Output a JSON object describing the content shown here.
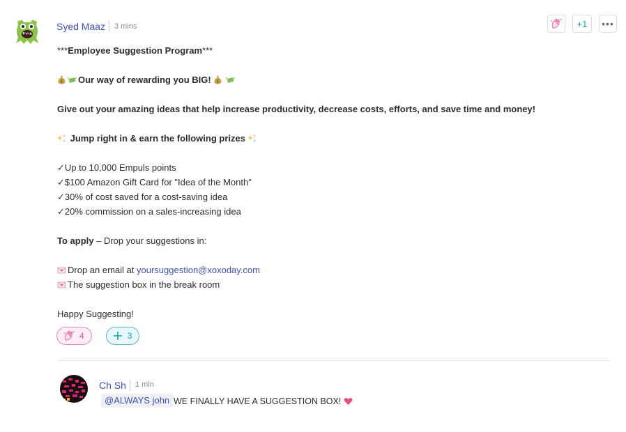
{
  "post": {
    "author": "Syed Maaz",
    "time": "3 mins",
    "plus_one_label": "+1",
    "more_label": "•••",
    "lines": [
      {
        "kind": "text",
        "parts": [
          {
            "t": "***",
            "b": false
          },
          {
            "t": "Employee Suggestion Program",
            "b": true
          },
          {
            "t": "***",
            "b": false
          }
        ]
      },
      {
        "kind": "gap"
      },
      {
        "kind": "text",
        "emoji_pre": [
          "money-bag-icon",
          "money-wings-icon"
        ],
        "parts": [
          {
            "t": "Our way of rewarding you BIG!",
            "b": true
          }
        ],
        "emoji_post": [
          "money-bag-icon",
          "money-wings-icon"
        ]
      },
      {
        "kind": "gap"
      },
      {
        "kind": "text",
        "parts": [
          {
            "t": "Give out your amazing ideas that help increase productivity, decrease costs, efforts, and save time and money!",
            "b": true
          }
        ]
      },
      {
        "kind": "gap"
      },
      {
        "kind": "text",
        "emoji_pre": [
          "sparkles-icon"
        ],
        "parts": [
          {
            "t": " Jump right in & earn the following prizes",
            "b": true
          }
        ],
        "emoji_post": [
          "sparkles-icon"
        ]
      },
      {
        "kind": "gap"
      },
      {
        "kind": "check",
        "text": "Up to 10,000 Empuls points"
      },
      {
        "kind": "check",
        "text": "$100 Amazon Gift Card for \"Idea of the Month\""
      },
      {
        "kind": "check",
        "text": "30% of cost saved for a cost-saving idea"
      },
      {
        "kind": "check",
        "text": "20% commission on a sales-increasing idea"
      },
      {
        "kind": "gap"
      },
      {
        "kind": "text",
        "parts": [
          {
            "t": "To apply",
            "b": true
          },
          {
            "t": " – Drop your suggestions in:",
            "b": false
          }
        ]
      },
      {
        "kind": "gap"
      },
      {
        "kind": "text",
        "emoji_pre": [
          "love-letter-icon"
        ],
        "parts": [
          {
            "t": "Drop an email at ",
            "b": false
          },
          {
            "t": "yoursuggestion@xoxoday.com",
            "b": false,
            "link": true
          }
        ]
      },
      {
        "kind": "text",
        "emoji_pre": [
          "love-letter-icon"
        ],
        "parts": [
          {
            "t": "The suggestion box in the break room",
            "b": false
          }
        ]
      },
      {
        "kind": "gap"
      },
      {
        "kind": "text",
        "parts": [
          {
            "t": "Happy Suggesting!",
            "b": false
          }
        ]
      }
    ],
    "reactions": [
      {
        "icon": "clap-icon",
        "count": "4"
      },
      {
        "icon": "plus-icon",
        "count": "3"
      }
    ]
  },
  "reply": {
    "author": "Ch Sh",
    "time": "1 min",
    "mention": "@ALWAYS john",
    "text": "WE FINALLY HAVE A SUGGESTION BOX!",
    "emoji": "heart-icon"
  },
  "colors": {
    "link": "#3f51b5",
    "clap_pink": "#e58ab6",
    "plus_teal": "#17a2b8"
  }
}
